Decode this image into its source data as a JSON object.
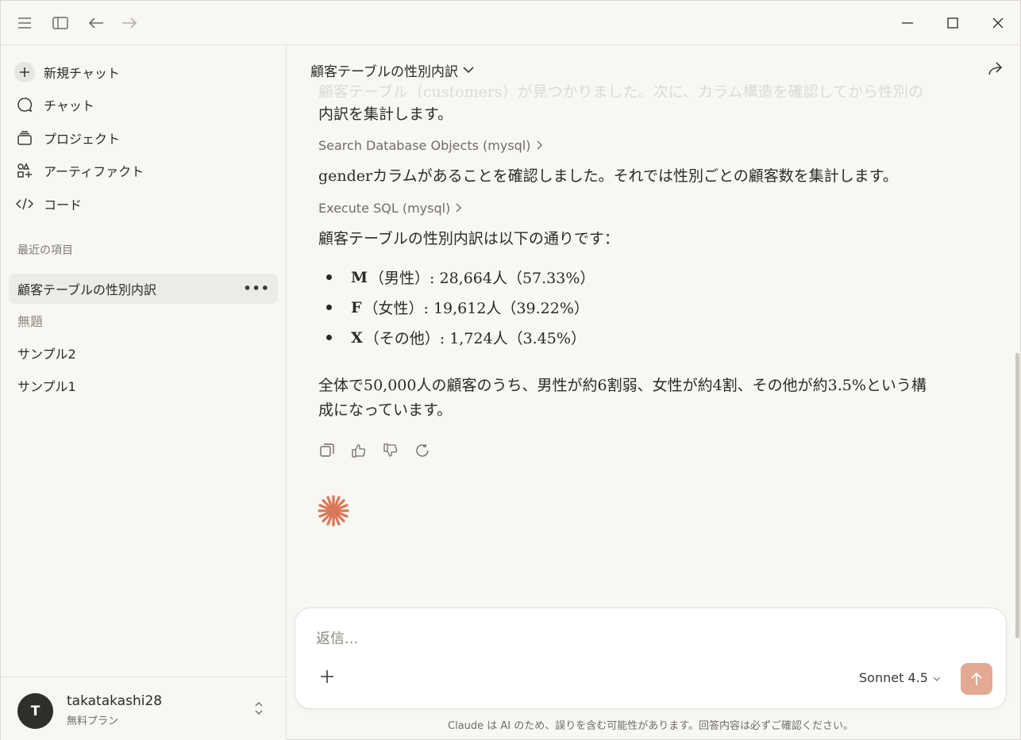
{
  "titlebar": {
    "icons": [
      "menu-icon",
      "sidebar-toggle-icon",
      "back-arrow-icon",
      "forward-arrow-icon",
      "minimize-icon",
      "maximize-icon",
      "close-icon"
    ]
  },
  "sidebar": {
    "nav": [
      {
        "label": "新規チャット",
        "icon": "plus-icon"
      },
      {
        "label": "チャット",
        "icon": "chat-bubble-icon"
      },
      {
        "label": "プロジェクト",
        "icon": "folder-stack-icon"
      },
      {
        "label": "アーティファクト",
        "icon": "artifacts-icon"
      },
      {
        "label": "コード",
        "icon": "code-icon"
      }
    ],
    "recent_label": "最近の項目",
    "recent": [
      {
        "label": "顧客テーブルの性別内訳",
        "active": true
      },
      {
        "label": "無題",
        "muted": true
      },
      {
        "label": "サンプル2"
      },
      {
        "label": "サンプル1"
      }
    ],
    "user": {
      "initial": "T",
      "name": "takatakashi28",
      "plan": "無料プラン"
    }
  },
  "chat": {
    "title": "顧客テーブルの性別内訳",
    "faded_line": "顧客テーブル（customers）が見つかりました。次に、カラム構造を確認してから性別の",
    "intro_line2": "内訳を集計します。",
    "tool1": "Search Database Objects (mysql)",
    "msg2": "genderカラムがあることを確認しました。それでは性別ごとの顧客数を集計します。",
    "tool2": "Execute SQL (mysql)",
    "msg3": "顧客テーブルの性別内訳は以下の通りです：",
    "bullets": [
      {
        "key": "M",
        "text": "（男性）: 28,664人（57.33%）"
      },
      {
        "key": "F",
        "text": "（女性）: 19,612人（39.22%）"
      },
      {
        "key": "X",
        "text": "（その他）: 1,724人（3.45%）"
      }
    ],
    "summary_line1": "全体で50,000人の顧客のうち、男性が約6割弱、女性が約4割、その他が約3.5%という構",
    "summary_line2": "成になっています。"
  },
  "composer": {
    "placeholder": "返信...",
    "model": "Sonnet 4.5"
  },
  "disclaimer": "Claude は AI のため、誤りを含む可能性があります。回答内容は必ずご確認ください。",
  "colors": {
    "background": "#f8f7f3",
    "accent": "#d97757",
    "send_button": "#e3a992",
    "active_item": "#ecebe5"
  }
}
